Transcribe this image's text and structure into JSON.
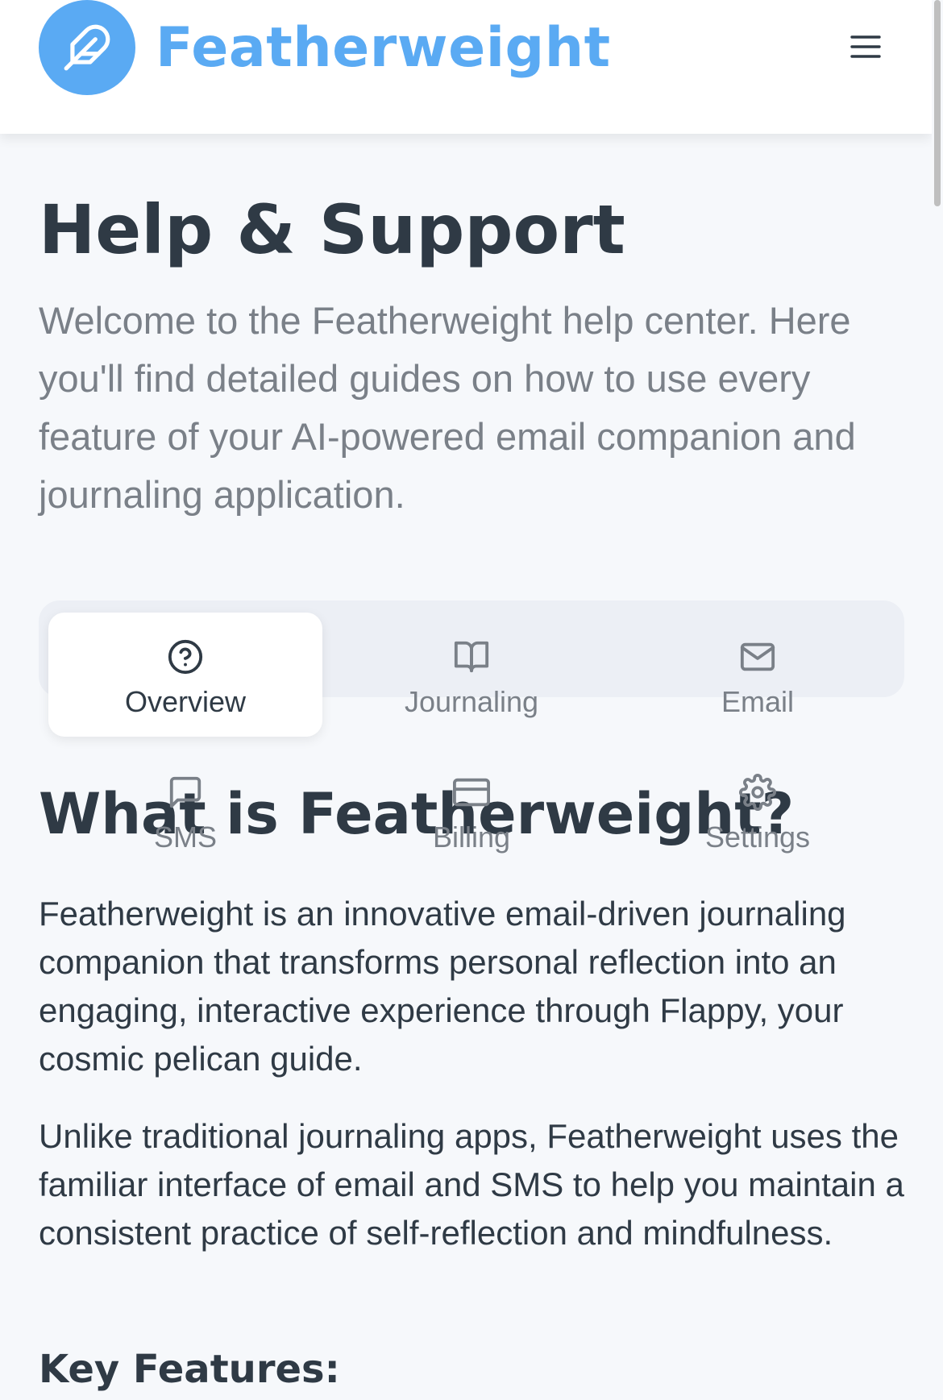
{
  "header": {
    "brand": "Featherweight",
    "logo_icon": "feather-icon",
    "menu_icon": "hamburger-menu-icon",
    "brand_color": "#5aaaf3"
  },
  "hero": {
    "title": "Help & Support",
    "intro": "Welcome to the Featherweight help center. Here you'll find detailed guides on how to use every feature of your AI-powered email companion and journaling application."
  },
  "tabs": [
    {
      "label": "Overview",
      "icon": "question-circle-icon",
      "active": true
    },
    {
      "label": "Journaling",
      "icon": "book-open-icon",
      "active": false
    },
    {
      "label": "Email",
      "icon": "mail-icon",
      "active": false
    },
    {
      "label": "SMS",
      "icon": "message-square-icon",
      "active": false
    },
    {
      "label": "Billing",
      "icon": "credit-card-icon",
      "active": false
    },
    {
      "label": "Settings",
      "icon": "gear-icon",
      "active": false
    }
  ],
  "section": {
    "title": "What is Featherweight?",
    "paragraphs": [
      "Featherweight is an innovative email-driven journaling companion that transforms personal reflection into an engaging, interactive experience through Flappy, your cosmic pelican guide.",
      "Unlike traditional journaling apps, Featherweight uses the familiar interface of email and SMS to help you maintain a consistent practice of self-reflection and mindfulness."
    ],
    "subheading": "Key Features:"
  }
}
